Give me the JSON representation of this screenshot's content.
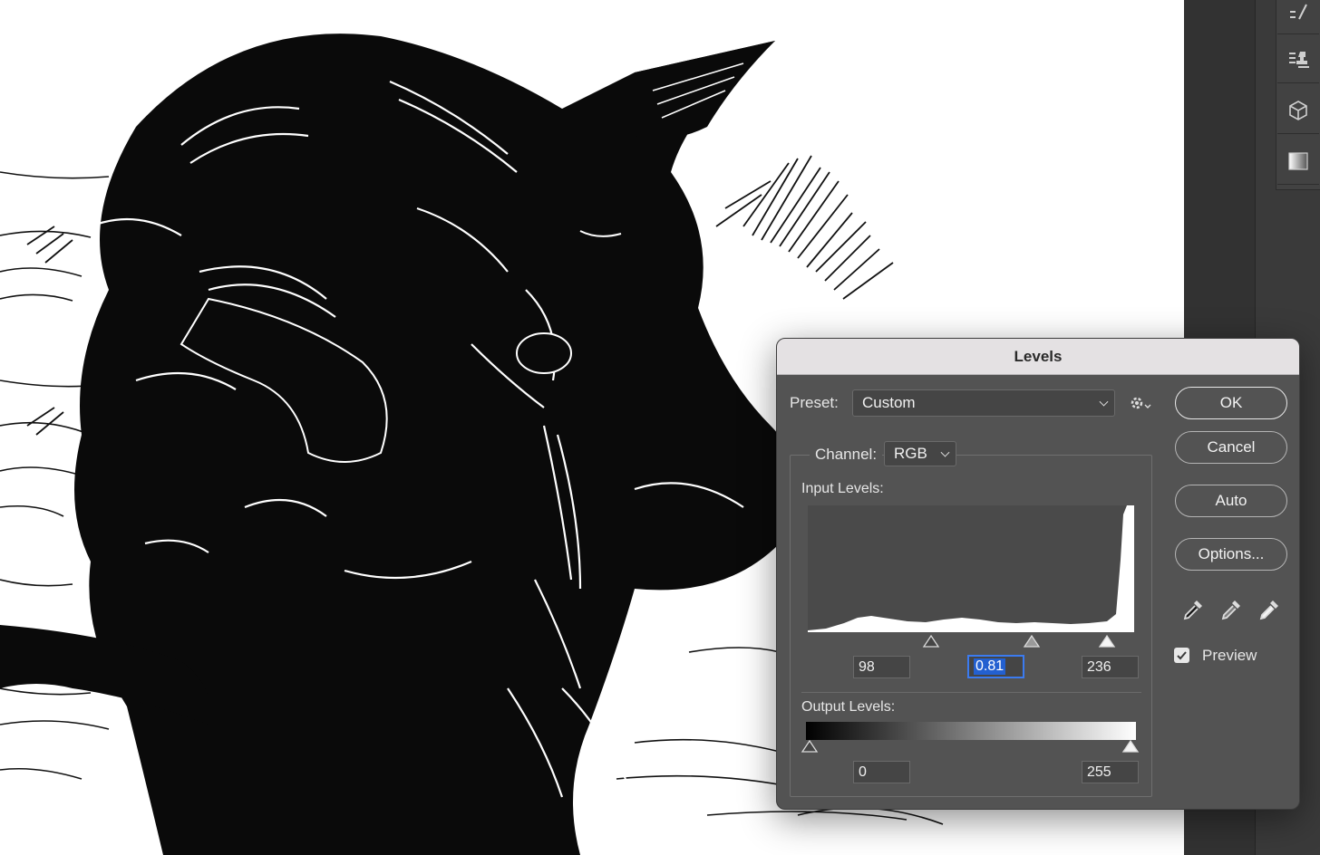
{
  "dialog": {
    "title": "Levels",
    "preset": {
      "label": "Preset:",
      "value": "Custom"
    },
    "channel": {
      "label": "Channel:",
      "value": "RGB"
    },
    "input_levels": {
      "label": "Input Levels:",
      "black": "98",
      "gamma": "0.81",
      "white": "236"
    },
    "output_levels": {
      "label": "Output Levels:",
      "black": "0",
      "white": "255"
    },
    "buttons": {
      "ok": "OK",
      "cancel": "Cancel",
      "auto": "Auto",
      "options": "Options..."
    },
    "preview": {
      "label": "Preview",
      "checked": true
    },
    "icons": {
      "preset_menu": "gear-icon",
      "eyedroppers": [
        "black-point-eyedropper-icon",
        "gray-point-eyedropper-icon",
        "white-point-eyedropper-icon"
      ]
    }
  },
  "side_panel": {
    "tools": [
      "brush-settings-icon",
      "clone-source-icon",
      "3d-icon",
      "gradient-icon"
    ]
  },
  "colors": {
    "dialog_bg": "#535353",
    "title_bar": "#e4e1e3",
    "selection": "#2360d0",
    "panel_bg": "#323232"
  }
}
